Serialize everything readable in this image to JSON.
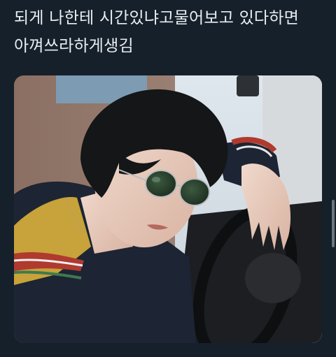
{
  "tweet": {
    "text_line1": "되게 나한테 시간있냐고물어보고 있다하면",
    "text_line2": "아껴쓰라하게생김"
  },
  "media": {
    "subject": "photo-person-in-car-with-round-sunglasses"
  },
  "colors": {
    "background": "#15202b",
    "text": "#e9edf1"
  }
}
